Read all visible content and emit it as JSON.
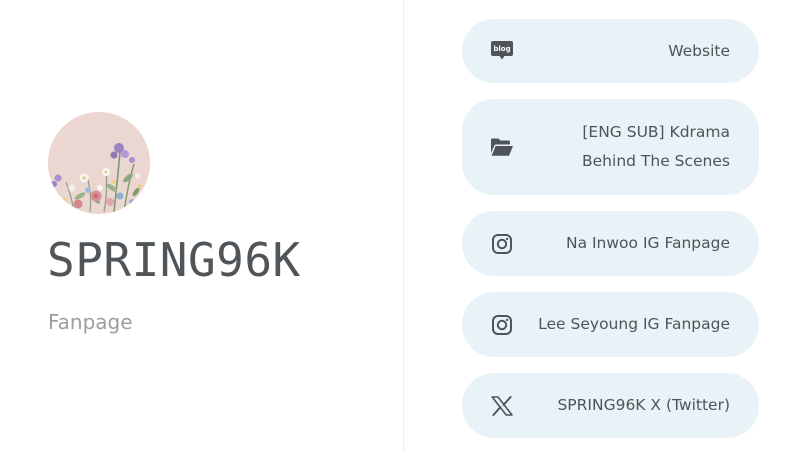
{
  "profile": {
    "name": "SPRING96K",
    "subtitle": "Fanpage"
  },
  "links": [
    {
      "label": "Website",
      "icon": "blog-icon"
    },
    {
      "label": "[ENG SUB] Kdrama Behind The Scenes",
      "icon": "folder-open-icon"
    },
    {
      "label": "Na Inwoo IG Fanpage",
      "icon": "instagram-icon"
    },
    {
      "label": "Lee Seyoung IG Fanpage",
      "icon": "instagram-icon"
    },
    {
      "label": "SPRING96K X (Twitter)",
      "icon": "x-twitter-icon"
    }
  ],
  "icon_labels": {
    "blog": "blog"
  },
  "colors": {
    "button_background": "#e9f2f6",
    "text": "#4e5459",
    "subtitle": "#9a9fa3",
    "avatar_background": "#ecd6d2"
  }
}
